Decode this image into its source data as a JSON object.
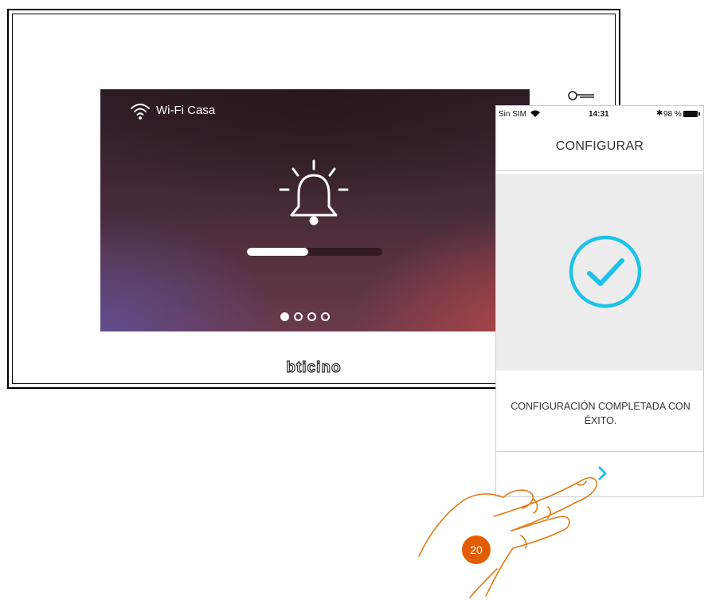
{
  "monitor": {
    "wifi_network": "Wi-Fi Casa",
    "wifi_icon": "wifi-icon",
    "bell_icon": "bell-ringing-icon",
    "key_icon": "key-icon",
    "progress": 0.45,
    "pager": {
      "total": 4,
      "active": 1
    },
    "brand": "bticino"
  },
  "phone": {
    "status_bar": {
      "carrier": "Sin SIM",
      "time": "14:31",
      "bluetooth": "✱",
      "battery": "98 %"
    },
    "title": "CONFIGURAR",
    "success_icon": "check-circle-icon",
    "message": "CONFIGURACIÓN COMPLETADA CON ÉXITO.",
    "next_icon": "chevron-right-icon"
  },
  "step": "20",
  "colors": {
    "accent": "#1cc2e8",
    "step_badge": "#e15d00",
    "hand_outline": "#e07b16"
  }
}
